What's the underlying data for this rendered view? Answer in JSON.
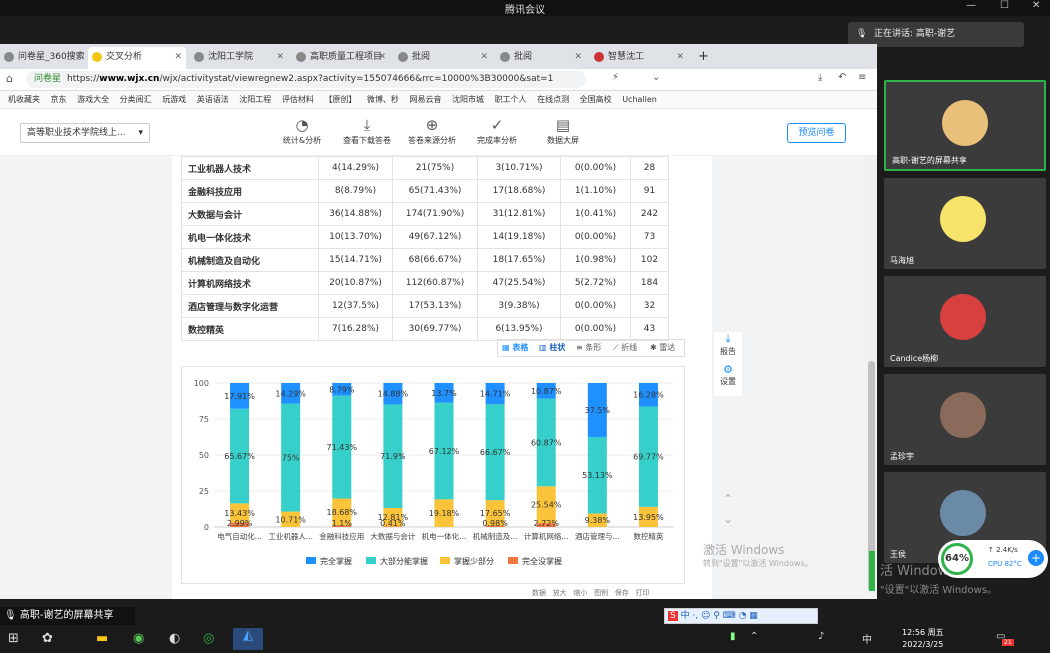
{
  "app": {
    "title": "腾讯会议",
    "window_controls": [
      "—",
      "☐",
      "✕"
    ]
  },
  "speaker": {
    "label": "正在讲话: 高职-谢艺"
  },
  "browser": {
    "tabs": [
      {
        "label": "问卷星_360搜索",
        "active": false
      },
      {
        "label": "交叉分析",
        "active": true
      },
      {
        "label": "沈阳工学院",
        "active": false
      },
      {
        "label": "高职质量工程项目",
        "active": false
      },
      {
        "label": "批阅",
        "active": false
      },
      {
        "label": "批阅",
        "active": false
      },
      {
        "label": "智慧沈工",
        "active": false
      }
    ],
    "new_tab": "+",
    "url_site_label": "问卷星",
    "url_prefix": "https://",
    "url_host": "www.wjx.cn",
    "url_path": "/wjx/activitystat/viewregnew2.aspx?activity=155074666&rrc=10000%3B30000&sat=1",
    "bookmarks": [
      "机收藏夹",
      "京东",
      "游戏大全",
      "分类阅汇",
      "玩游戏",
      "英语语法",
      "沈阳工程",
      "评估材料",
      "【原创】",
      "微博、秒",
      "网易云音",
      "沈阳市城",
      "职工个人",
      "在线点测",
      "全国高校",
      "Uchallen"
    ]
  },
  "toolbar": {
    "survey_select": "高等职业技术学院线上...",
    "tools": [
      "统计&分析",
      "查看下载答卷",
      "答卷来源分析",
      "完成率分析",
      "数据大屏"
    ],
    "preview": "预览问卷"
  },
  "table": {
    "rows": [
      {
        "name": "工业机器人技术",
        "c1": "4(14.29%)",
        "c2": "21(75%)",
        "c3": "3(10.71%)",
        "c4": "0(0.00%)",
        "total": "28"
      },
      {
        "name": "金融科技应用",
        "c1": "8(8.79%)",
        "c2": "65(71.43%)",
        "c3": "17(18.68%)",
        "c4": "1(1.10%)",
        "total": "91"
      },
      {
        "name": "大数据与会计",
        "c1": "36(14.88%)",
        "c2": "174(71.90%)",
        "c3": "31(12.81%)",
        "c4": "1(0.41%)",
        "total": "242"
      },
      {
        "name": "机电一体化技术",
        "c1": "10(13.70%)",
        "c2": "49(67.12%)",
        "c3": "14(19.18%)",
        "c4": "0(0.00%)",
        "total": "73"
      },
      {
        "name": "机械制造及自动化",
        "c1": "15(14.71%)",
        "c2": "68(66.67%)",
        "c3": "18(17.65%)",
        "c4": "1(0.98%)",
        "total": "102"
      },
      {
        "name": "计算机网络技术",
        "c1": "20(10.87%)",
        "c2": "112(60.87%)",
        "c3": "47(25.54%)",
        "c4": "5(2.72%)",
        "total": "184"
      },
      {
        "name": "酒店管理与数字化运营",
        "c1": "12(37.5%)",
        "c2": "17(53.13%)",
        "c3": "3(9.38%)",
        "c4": "0(0.00%)",
        "total": "32"
      },
      {
        "name": "数控精英",
        "c1": "7(16.28%)",
        "c2": "30(69.77%)",
        "c3": "6(13.95%)",
        "c4": "0(0.00%)",
        "total": "43"
      }
    ]
  },
  "view_buttons": {
    "table": "表格",
    "column": "柱状",
    "bar": "条形",
    "line": "折线",
    "radar": "雷达"
  },
  "side_tools": {
    "report": "报告",
    "settings": "设置"
  },
  "pager": [
    "数据",
    "放大",
    "缩小",
    "图例",
    "保存",
    "打印"
  ],
  "chart_data": {
    "type": "bar",
    "stacked": true,
    "categories": [
      "电气自动化...",
      "工业机器人...",
      "金融科技应用",
      "大数据与会计",
      "机电一体化...",
      "机械制造及...",
      "计算机网络...",
      "酒店管理与...",
      "数控精英"
    ],
    "ylim": [
      0,
      100
    ],
    "yticks": [
      0,
      25,
      50,
      75,
      100
    ],
    "series": [
      {
        "name": "完全掌握",
        "color": "#1e90ff",
        "values": [
          17.91,
          14.29,
          8.79,
          14.88,
          13.7,
          14.71,
          10.87,
          37.5,
          16.28
        ],
        "labels": [
          "17.91%",
          "14.29%",
          "8.79%",
          "14.88%",
          "13.7%",
          "14.71%",
          "10.87%",
          "37.5%",
          "16.28%"
        ]
      },
      {
        "name": "大部分能掌握",
        "color": "#36cfc9",
        "values": [
          65.67,
          75,
          71.43,
          71.9,
          67.12,
          66.67,
          60.87,
          53.13,
          69.77
        ],
        "labels": [
          "65.67%",
          "75%",
          "71.43%",
          "71.9%",
          "67.12%",
          "66.67%",
          "60.87%",
          "53.13%",
          "69.77%"
        ]
      },
      {
        "name": "掌握少部分",
        "color": "#fac33a",
        "values": [
          13.43,
          10.71,
          18.68,
          12.81,
          19.18,
          17.65,
          25.54,
          9.38,
          13.95
        ],
        "labels": [
          "13.43%",
          "10.71%",
          "18.68%",
          "12.81%",
          "19.18%",
          "17.65%",
          "25.54%",
          "9.38%",
          "13.95%"
        ]
      },
      {
        "name": "完全没掌握",
        "color": "#f07840",
        "values": [
          2.99,
          0,
          1.1,
          0.41,
          0,
          0.98,
          2.72,
          0,
          0
        ],
        "labels": [
          "2.99%",
          "",
          "1.1%",
          "0.41%",
          "",
          "0.98%",
          "2.72%",
          "",
          ""
        ]
      }
    ],
    "legend_position": "bottom"
  },
  "watermark": {
    "line1": "激活 Windows",
    "line2": "转到\"设置\"以激活 Windows。",
    "line3": "活 Windows",
    "line4": "\"设置\"以激活 Windows。"
  },
  "participants": [
    {
      "name": "高职-谢艺的屏幕共享",
      "avatar_color": "#e8c07a"
    },
    {
      "name": "马海旭",
      "avatar_color": "#f5e36a"
    },
    {
      "name": "Candice杨柳",
      "avatar_color": "#d84040"
    },
    {
      "name": "孟珍宇",
      "avatar_color": "#8a6a5a"
    },
    {
      "name": "王侯",
      "avatar_color": "#6a8aa8"
    }
  ],
  "sysmon": {
    "cpu_percent": "64%",
    "net": "2.4K/s",
    "cpu_temp": "CPU 82°C"
  },
  "share_label": "高职-谢艺的屏幕共享",
  "ime": "中 ·, ☺ ⚲ ⌨ ◔ ▦",
  "clock": {
    "time": "12:56 周五",
    "date": "2022/3/25"
  },
  "taskbar_badge": "21"
}
